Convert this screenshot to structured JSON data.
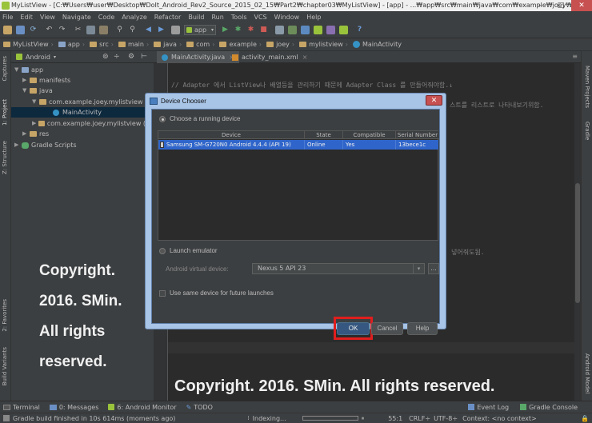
{
  "window": {
    "title": "MyListView - [C:₩Users₩user₩Desktop₩DoIt_Android_Rev2_Source_2015_02_15₩Part2₩chapter03₩MyListView] - [app] - ...₩app₩src₩main₩java₩com₩example₩joey₩mylistview₩Main...",
    "min": "–",
    "max": "□",
    "close": "✕"
  },
  "menu": [
    "File",
    "Edit",
    "View",
    "Navigate",
    "Code",
    "Analyze",
    "Refactor",
    "Build",
    "Run",
    "Tools",
    "VCS",
    "Window",
    "Help"
  ],
  "toolbar": {
    "run_config": "app"
  },
  "breadcrumbs": [
    "MyListView",
    "app",
    "src",
    "main",
    "java",
    "com",
    "example",
    "joey",
    "mylistview",
    "MainActivity"
  ],
  "project_panel": {
    "view_selector": "Android",
    "tree": [
      {
        "label": "app",
        "level": 0,
        "icon": "module-folder-icon",
        "expanded": true
      },
      {
        "label": "manifests",
        "level": 1,
        "icon": "folder-icon",
        "expanded": false
      },
      {
        "label": "java",
        "level": 1,
        "icon": "folder-icon",
        "expanded": true
      },
      {
        "label": "com.example.joey.mylistview",
        "level": 2,
        "icon": "package-icon",
        "expanded": true
      },
      {
        "label": "MainActivity",
        "level": 3,
        "icon": "class-icon",
        "selected": true
      },
      {
        "label": "com.example.joey.mylistview (an",
        "level": 2,
        "icon": "package-icon",
        "expanded": false
      },
      {
        "label": "res",
        "level": 1,
        "icon": "folder-icon",
        "expanded": false
      },
      {
        "label": "Gradle Scripts",
        "level": 0,
        "icon": "gradle-icon",
        "expanded": false
      }
    ]
  },
  "left_tool_windows": [
    "Captures",
    "1: Project",
    "Z: Structure",
    "2: Favorites",
    "Build Variants"
  ],
  "right_tool_windows": [
    "Maven Projects",
    "Gradle",
    "Android Model"
  ],
  "editor": {
    "tabs": [
      {
        "label": "MainActivity.java",
        "active": true
      },
      {
        "label": "activity_main.xml",
        "active": false
      }
    ],
    "lines": [
      {
        "text": "// Adapter 에서 ListView나 배열등을 관리하기 때문에 Adapter Class 를 만들어줘야함.↓"
      },
      {
        "text": "스트를 리스트로 나타내보기위함."
      },
      {
        "text": "넣어줘도됨."
      }
    ]
  },
  "dialog": {
    "title": "Device Chooser",
    "choose_running": "Choose a running device",
    "table_headers": [
      "Device",
      "State",
      "Compatible",
      "Serial Number"
    ],
    "rows": [
      {
        "device": "Samsung SM-G720N0 Android 4.4.4 (API 19)",
        "state": "Online",
        "compatible": "Yes",
        "serial": "13bece1c"
      }
    ],
    "launch_emulator": "Launch emulator",
    "avd_label": "Android virtual device:",
    "avd_value": "Nexus 5 API 23",
    "avd_more": "...",
    "same_device": "Use same device for future launches",
    "ok": "OK",
    "cancel": "Cancel",
    "help": "Help"
  },
  "watermarks": {
    "left": [
      "Copyright.",
      "2016. SMin.",
      "All rights",
      "reserved."
    ],
    "bottom": "Copyright. 2016. SMin. All rights reserved."
  },
  "bottom_tools": [
    {
      "label": "Terminal",
      "icon": "terminal-icon"
    },
    {
      "label": "0: Messages",
      "icon": "messages-icon"
    },
    {
      "label": "6: Android Monitor",
      "icon": "android-icon"
    },
    {
      "label": "TODO",
      "icon": "todo-icon"
    }
  ],
  "bottom_tools_right": [
    {
      "label": "Event Log",
      "icon": "event-log-icon"
    },
    {
      "label": "Gradle Console",
      "icon": "gradle-console-icon"
    }
  ],
  "status": {
    "message": "Gradle build finished in 10s 614ms (moments ago)",
    "indexing": "Indexing...",
    "position": "55:1",
    "line_sep": "CRLF÷",
    "encoding": "UTF-8÷",
    "context": "Context: <no context>"
  },
  "colors": {
    "accent_red": "#e01e1e",
    "selection": "#2f65ca",
    "ok_button": "#365880"
  }
}
